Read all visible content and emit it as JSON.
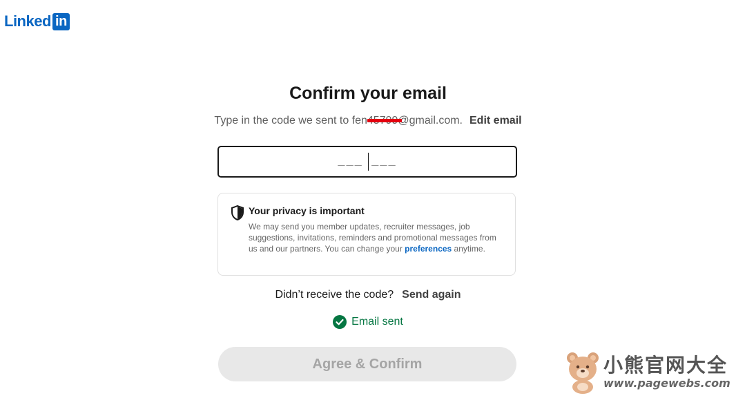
{
  "brand": {
    "word": "Linked",
    "box": "in",
    "color": "#0a66c2"
  },
  "page": {
    "title": "Confirm your email",
    "subtitle_prefix": "Type in the code we sent to ",
    "email_visible_start": "fen",
    "email_redacted": "45799",
    "email_visible_end": "@gmail.com.",
    "edit_email": "Edit email"
  },
  "code_input": {
    "placeholder": "___ ___",
    "value": ""
  },
  "privacy": {
    "icon": "shield-icon",
    "title": "Your privacy is important",
    "body": "We may send you member updates, recruiter messages, job suggestions, invitations, reminders and promotional messages from us and our partners. You can change your ",
    "link": "preferences",
    "after_link": " anytime."
  },
  "resend": {
    "question": "Didn’t receive the code?",
    "action": "Send again"
  },
  "status": {
    "icon": "check-circle-icon",
    "text": "Email sent",
    "color": "#057642"
  },
  "primary_button": {
    "label": "Agree & Confirm",
    "enabled": false
  },
  "watermark": {
    "cn": "小熊官网大全",
    "url": "www.pagewebs.com"
  }
}
